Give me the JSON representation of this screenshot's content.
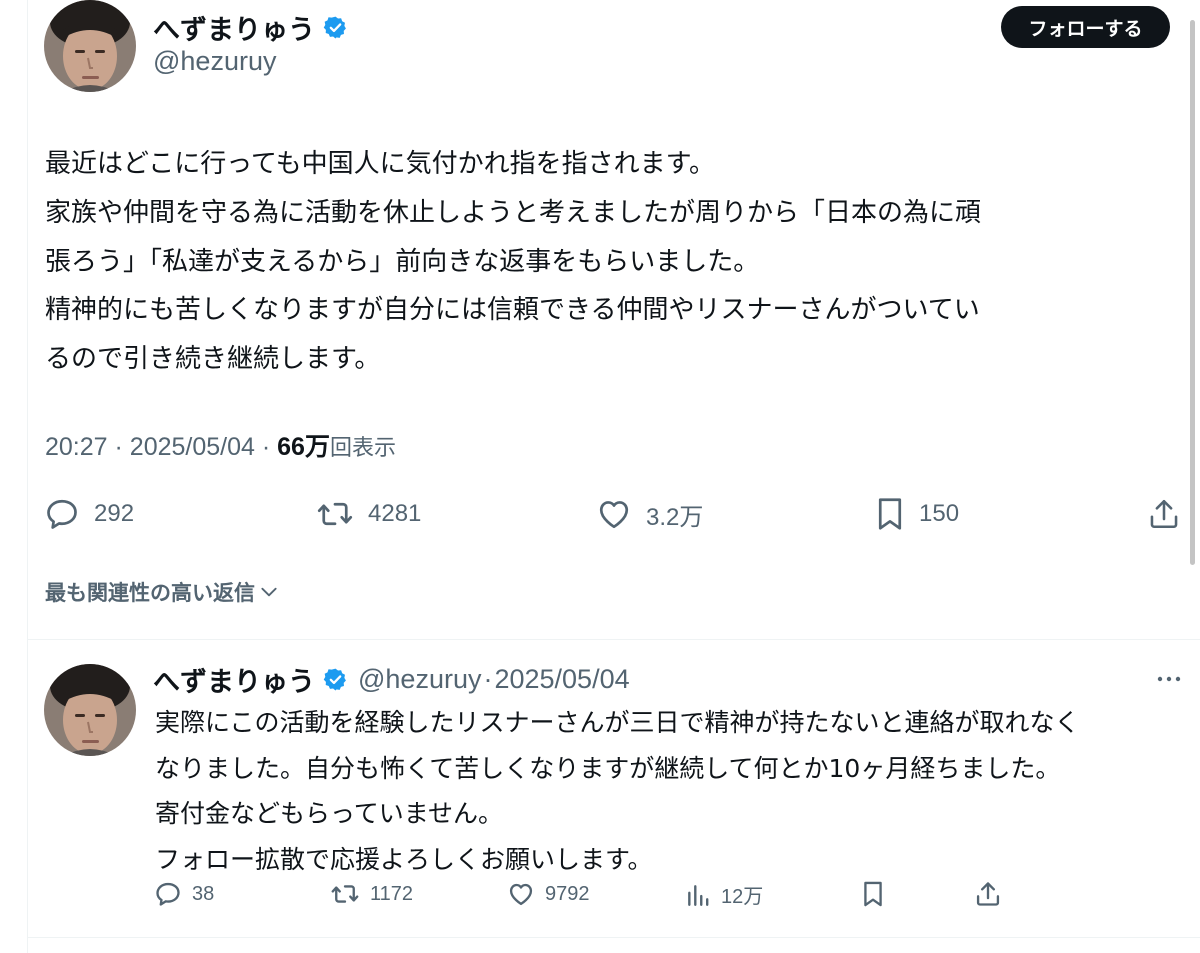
{
  "main_tweet": {
    "display_name": "へずまりゅう",
    "handle": "@hezuruy",
    "follow_label": "フォローする",
    "body_lines": [
      "最近はどこに行っても中国人に気付かれ指を指されます。",
      "家族や仲間を守る為に活動を休止しようと考えましたが周りから「日本の為に頑",
      "張ろう」「私達が支えるから」前向きな返事をもらいました。",
      "精神的にも苦しくなりますが自分には信頼できる仲間やリスナーさんがついてい",
      "るので引き続き継続します。"
    ],
    "time": "20:27",
    "date": "2025/05/04",
    "separator": "·",
    "views_count": "66万",
    "views_label": "回表示",
    "replies": "292",
    "reposts": "4281",
    "likes": "3.2万",
    "bookmarks": "150"
  },
  "reply_sort": {
    "label": "最も関連性の高い返信"
  },
  "reply_tweet": {
    "display_name": "へずまりゅう",
    "handle": "@hezuruy",
    "separator": "·",
    "date": "2025/05/04",
    "body_lines": [
      "実際にこの活動を経験したリスナーさんが三日で精神が持たないと連絡が取れなく",
      "なりました。自分も怖くて苦しくなりますが継続して何とか10ヶ月経ちました。",
      "寄付金などもらっていません。",
      "フォロー拡散で応援よろしくお願いします。"
    ],
    "replies": "38",
    "reposts": "1172",
    "likes": "9792",
    "views": "12万"
  },
  "colors": {
    "text": "#0f1419",
    "secondary": "#536471",
    "verified": "#1d9bf0",
    "follow_bg": "#0f1419",
    "divider": "#eff3f4"
  },
  "icons": [
    "verified-badge-icon",
    "reply-icon",
    "repost-icon",
    "like-icon",
    "bookmark-icon",
    "share-icon",
    "views-icon",
    "more-icon",
    "chevron-down-icon"
  ]
}
